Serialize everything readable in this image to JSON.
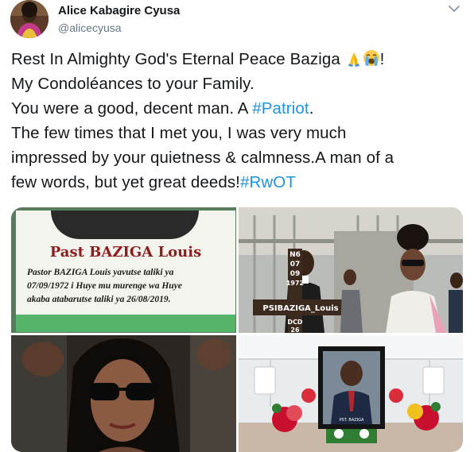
{
  "author": {
    "display_name": "Alice Kabagire Cyusa",
    "handle": "@alicecyusa"
  },
  "tweet": {
    "line1": "Rest In Almighty God's Eternal Peace Baziga ",
    "line1_end": "!",
    "line2": "My Condoléances to your Family.",
    "line3": "You were a good, decent man. A ",
    "hashtag_patriot": "#Patriot",
    "line3_end": ".",
    "line4": "The few times that I met you, I was very much",
    "line5": "impressed by your quietness & calmness.A man of a",
    "line6": "few words, but yet great deeds!",
    "hashtag_rwot": "#RwOT",
    "emojis": [
      "folded-hands-icon",
      "loudly-crying-face-icon"
    ]
  },
  "media": {
    "notice": {
      "title": "Past BAZIGA Louis",
      "body_lines": [
        "Pastor BAZIGA Louis yavutse taliki ya",
        "07/09/1972 i Huye mu murenge wa Huye",
        "akaba atabarutse taliki ya 26/08/2019."
      ]
    },
    "cross": {
      "vertical_text": [
        "N6",
        "07",
        "09",
        "1972"
      ],
      "horizontal_text": "PSIBAZIGA_Louis",
      "lower_text": [
        "DCD",
        "26"
      ]
    },
    "frame": {
      "caption": "PST. BAZIGA"
    }
  },
  "colors": {
    "hashtag": "#1b95e0",
    "text": "#14171a",
    "secondary": "#657786",
    "notice_title": "#8c1e1e",
    "notice_stripe": "#55b36a"
  }
}
